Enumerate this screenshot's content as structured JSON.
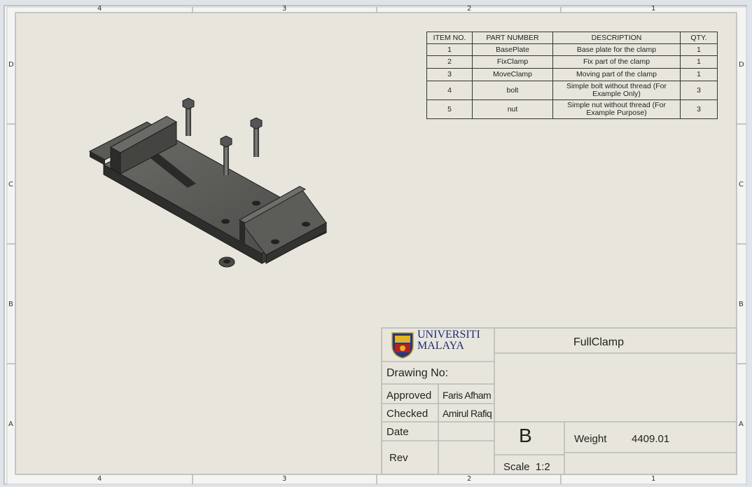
{
  "border": {
    "columns": [
      "4",
      "3",
      "2",
      "1"
    ],
    "rows": [
      "D",
      "C",
      "B",
      "A"
    ]
  },
  "bom": {
    "headers": [
      "ITEM NO.",
      "PART NUMBER",
      "DESCRIPTION",
      "QTY."
    ],
    "rows": [
      {
        "item": "1",
        "part": "BasePlate",
        "desc": "Base plate for the clamp",
        "qty": "1"
      },
      {
        "item": "2",
        "part": "FixClamp",
        "desc": "Fix part of the clamp",
        "qty": "1"
      },
      {
        "item": "3",
        "part": "MoveClamp",
        "desc": "Moving part of the clamp",
        "qty": "1"
      },
      {
        "item": "4",
        "part": "bolt",
        "desc": "Simple bolt without thread (For Example Only)",
        "qty": "3"
      },
      {
        "item": "5",
        "part": "nut",
        "desc": "Simple nut without thread (For Example Purpose)",
        "qty": "3"
      }
    ]
  },
  "title_block": {
    "logo_line1": "UNIVERSITI",
    "logo_line2": "MALAYA",
    "title": "FullClamp",
    "drawing_no_label": "Drawing No:",
    "approved_label": "Approved",
    "approved_by": "Faris Afham",
    "checked_label": "Checked",
    "checked_by": "Amirul Rafiq",
    "date_label": "Date",
    "rev_label": "Rev",
    "size": "B",
    "scale": "Scale  1:2",
    "weight_label": "Weight",
    "weight_value": "4409.01"
  },
  "colors": {
    "sheet": "#e8e6dc",
    "border_outer": "#f2f2f2",
    "frame": "#b9bbbd",
    "part_dark": "#3c3c3c"
  }
}
